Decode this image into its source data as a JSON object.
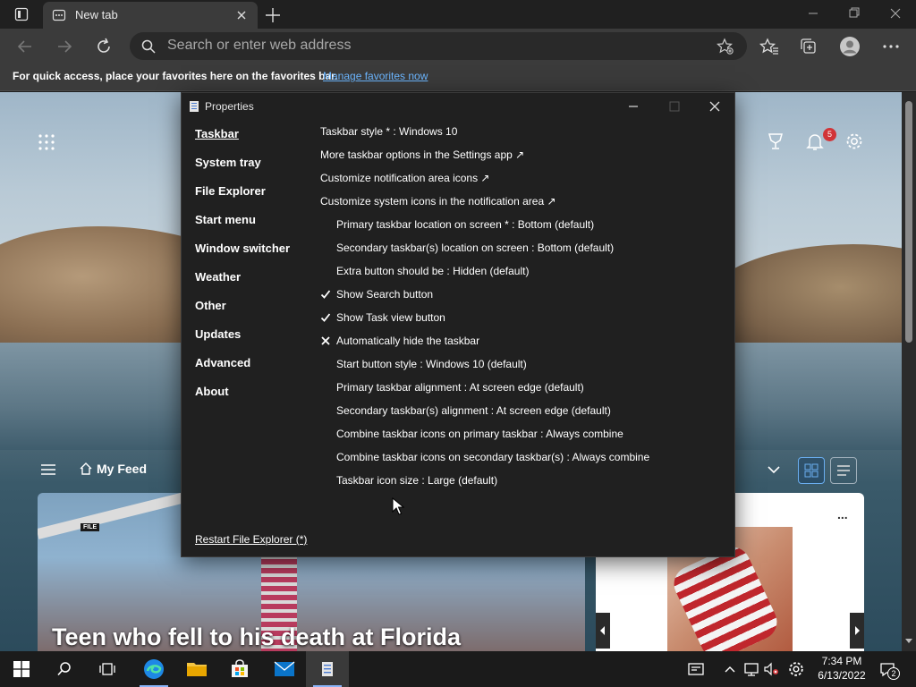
{
  "browser": {
    "tab_title": "New tab",
    "address_placeholder": "Search or enter web address",
    "favorites_bar_text": "For quick access, place your favorites here on the favorites bar.",
    "favorites_bar_link": "Manage favorites now"
  },
  "newtab": {
    "notification_count": "5",
    "feed_label": "My Feed",
    "headline": "Teen who fell to his death at Florida",
    "file_badge": "FILE",
    "side_more": "..."
  },
  "dialog": {
    "title": "Properties",
    "nav": [
      {
        "label": "Taskbar",
        "active": true
      },
      {
        "label": "System tray"
      },
      {
        "label": "File Explorer"
      },
      {
        "label": "Start menu"
      },
      {
        "label": "Window switcher"
      },
      {
        "label": "Weather"
      },
      {
        "label": "Other"
      },
      {
        "label": "Updates"
      },
      {
        "label": "Advanced"
      },
      {
        "label": "About"
      }
    ],
    "options": [
      {
        "text": "Taskbar style * : Windows 10",
        "mark": ""
      },
      {
        "text": "More taskbar options in the Settings app ↗",
        "mark": ""
      },
      {
        "text": "Customize notification area icons ↗",
        "mark": ""
      },
      {
        "text": "Customize system icons in the notification area ↗",
        "mark": ""
      },
      {
        "text": "Primary taskbar location on screen * : Bottom (default)",
        "mark": ""
      },
      {
        "text": "Secondary taskbar(s) location on screen : Bottom (default)",
        "mark": ""
      },
      {
        "text": "Extra button should be : Hidden (default)",
        "mark": ""
      },
      {
        "text": "Show Search button",
        "mark": "check"
      },
      {
        "text": "Show Task view button",
        "mark": "check"
      },
      {
        "text": "Automatically hide the taskbar",
        "mark": "cross"
      },
      {
        "text": "Start button style : Windows 10 (default)",
        "mark": ""
      },
      {
        "text": "Primary taskbar alignment : At screen edge (default)",
        "mark": ""
      },
      {
        "text": "Secondary taskbar(s) alignment : At screen edge (default)",
        "mark": ""
      },
      {
        "text": "Combine taskbar icons on primary taskbar : Always combine",
        "mark": ""
      },
      {
        "text": "Combine taskbar icons on secondary taskbar(s) : Always combine",
        "mark": ""
      },
      {
        "text": "Taskbar icon size : Large (default)",
        "mark": ""
      }
    ],
    "restart_label": "Restart File Explorer (*)"
  },
  "taskbar": {
    "time": "7:34 PM",
    "date": "6/13/2022",
    "notifications": "2"
  },
  "colors": {
    "accent_link": "#6cb6ff",
    "dialog_bg": "#202020",
    "taskbar_bg": "#1b1b1b",
    "badge_red": "#d13438"
  }
}
